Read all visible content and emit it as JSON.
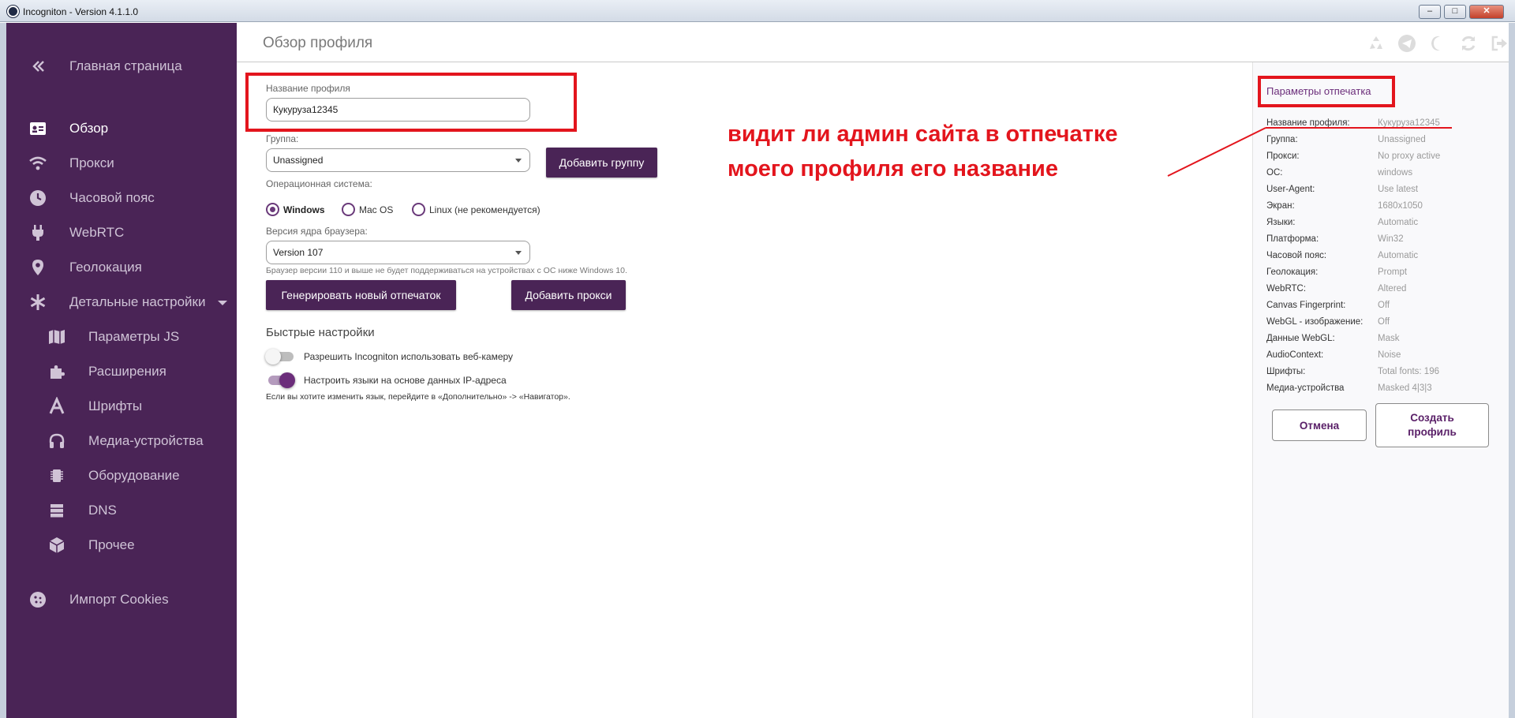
{
  "window": {
    "title": "Incogniton - Version 4.1.1.0",
    "minimize": "–",
    "maximize": "□",
    "close": "✕"
  },
  "sidebar": {
    "items": [
      {
        "label": "Главная страница",
        "icon": "double-chevron-left-icon"
      },
      {
        "label": "Обзор",
        "icon": "profile-card-icon",
        "active": true
      },
      {
        "label": "Прокси",
        "icon": "wifi-icon"
      },
      {
        "label": "Часовой пояс",
        "icon": "clock-icon"
      },
      {
        "label": "WebRTC",
        "icon": "plug-icon"
      },
      {
        "label": "Геолокация",
        "icon": "map-pin-icon"
      },
      {
        "label": "Детальные настройки",
        "icon": "asterisk-icon",
        "expanded": true
      },
      {
        "label": "Параметры JS",
        "icon": "map-icon"
      },
      {
        "label": "Расширения",
        "icon": "puzzle-icon"
      },
      {
        "label": "Шрифты",
        "icon": "font-icon"
      },
      {
        "label": "Медиа-устройства",
        "icon": "headphones-icon"
      },
      {
        "label": "Оборудование",
        "icon": "chip-icon"
      },
      {
        "label": "DNS",
        "icon": "server-icon"
      },
      {
        "label": "Прочее",
        "icon": "box-icon"
      },
      {
        "label": "Импорт Cookies",
        "icon": "cookie-icon"
      }
    ]
  },
  "header": {
    "title": "Обзор профиля",
    "icons": [
      "recycle-icon",
      "telegram-icon",
      "moon-icon",
      "refresh-icon",
      "logout-icon"
    ]
  },
  "form": {
    "profile_name_label": "Название профиля",
    "profile_name_value": "Кукуруза12345",
    "group_label": "Группа:",
    "group_value": "Unassigned",
    "add_group_button": "Добавить группу",
    "os_label": "Операционная система:",
    "os_options": [
      "Windows",
      "Mac OS",
      "Linux (не рекомендуется)"
    ],
    "os_selected": "Windows",
    "browser_version_label": "Версия ядра браузера:",
    "browser_version_value": "Version 107",
    "browser_note": "Браузер версии 110 и выше не будет поддерживаться на устройствах с ОС ниже Windows 10.",
    "generate_button": "Генерировать новый отпечаток",
    "add_proxy_button": "Добавить прокси",
    "quick_settings_title": "Быстрые настройки",
    "toggle_webcam_label": "Разрешить Incogniton использовать веб-камеру",
    "toggle_webcam_on": false,
    "toggle_lang_label": "Настроить языки на основе данных IP-адреса",
    "toggle_lang_on": true,
    "lang_note": "Если вы хотите изменить язык, перейдите в «Дополнительно» -> «Навигатор»."
  },
  "fingerprint": {
    "title": "Параметры отпечатка",
    "rows": [
      {
        "key": "Название профиля:",
        "value": "Кукуруза12345"
      },
      {
        "key": "Группа:",
        "value": "Unassigned"
      },
      {
        "key": "Прокси:",
        "value": "No proxy active"
      },
      {
        "key": "ОС:",
        "value": "windows"
      },
      {
        "key": "User-Agent:",
        "value": "Use latest"
      },
      {
        "key": "Экран:",
        "value": "1680x1050"
      },
      {
        "key": "Языки:",
        "value": "Automatic"
      },
      {
        "key": "Платформа:",
        "value": "Win32"
      },
      {
        "key": "Часовой пояс:",
        "value": "Automatic"
      },
      {
        "key": "Геолокация:",
        "value": "Prompt"
      },
      {
        "key": "WebRTC:",
        "value": "Altered"
      },
      {
        "key": "Canvas Fingerprint:",
        "value": "Off"
      },
      {
        "key": "WebGL - изображение:",
        "value": "Off"
      },
      {
        "key": "Данные WebGL:",
        "value": "Mask"
      },
      {
        "key": "AudioContext:",
        "value": "Noise"
      },
      {
        "key": "Шрифты:",
        "value": "Total fonts: 196"
      },
      {
        "key": "Медиа-устройства",
        "value": "Masked 4|3|3"
      }
    ],
    "cancel_button": "Отмена",
    "create_button": "Создать профиль"
  },
  "annotation": {
    "line1": "видит ли админ сайта в отпечатке",
    "line2": "моего профиля  его название",
    "color": "#e3151d"
  },
  "colors": {
    "sidebar_bg": "#4a2456",
    "accent": "#6b2d7a",
    "annotation_red": "#e3151d"
  }
}
